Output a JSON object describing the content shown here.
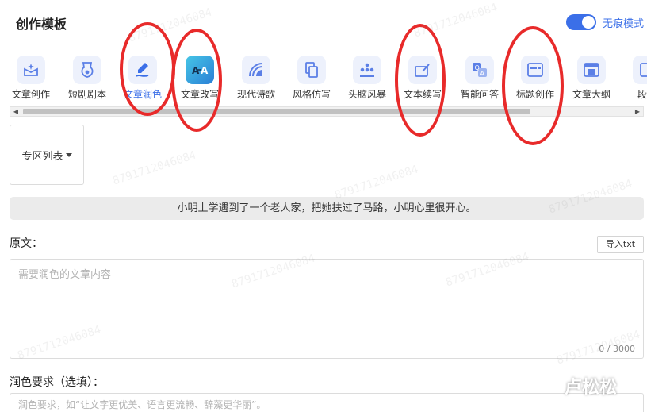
{
  "header": {
    "title": "创作模板",
    "mode_label": "无痕模式",
    "mode_on": true
  },
  "tools": [
    {
      "label": "文章创作",
      "icon": "article-create-icon",
      "active": false
    },
    {
      "label": "短剧剧本",
      "icon": "short-drama-script-icon",
      "active": false
    },
    {
      "label": "文章润色",
      "icon": "article-polish-icon",
      "active": true
    },
    {
      "label": "文章改写",
      "icon": "article-rewrite-icon",
      "active": false
    },
    {
      "label": "现代诗歌",
      "icon": "modern-poetry-icon",
      "active": false
    },
    {
      "label": "风格仿写",
      "icon": "style-imitation-icon",
      "active": false
    },
    {
      "label": "头脑风暴",
      "icon": "brainstorm-icon",
      "active": false
    },
    {
      "label": "文本续写",
      "icon": "text-continuation-icon",
      "active": false
    },
    {
      "label": "智能问答",
      "icon": "smart-qa-icon",
      "active": false
    },
    {
      "label": "标题创作",
      "icon": "title-create-icon",
      "active": false
    },
    {
      "label": "文章大纲",
      "icon": "article-outline-icon",
      "active": false
    },
    {
      "label": "段落",
      "icon": "paragraph-icon",
      "active": false
    }
  ],
  "zone": {
    "label": "专区列表"
  },
  "example": {
    "text": "小明上学遇到了一个老人家，把她扶过了马路，小明心里很开心。"
  },
  "original": {
    "label": "原文：",
    "import_label": "导入txt",
    "placeholder": "需要润色的文章内容",
    "value": "",
    "counter": "0 / 3000"
  },
  "requirement": {
    "label": "润色要求（选填）：",
    "placeholder": "润色要求，如“让文字更优美、语言更流畅、辞藻更华丽”。",
    "value": ""
  },
  "watermark": "8791712046084",
  "signature": "卢松松",
  "colors": {
    "accent": "#3b6fe8",
    "annotation": "#e82a2a"
  }
}
